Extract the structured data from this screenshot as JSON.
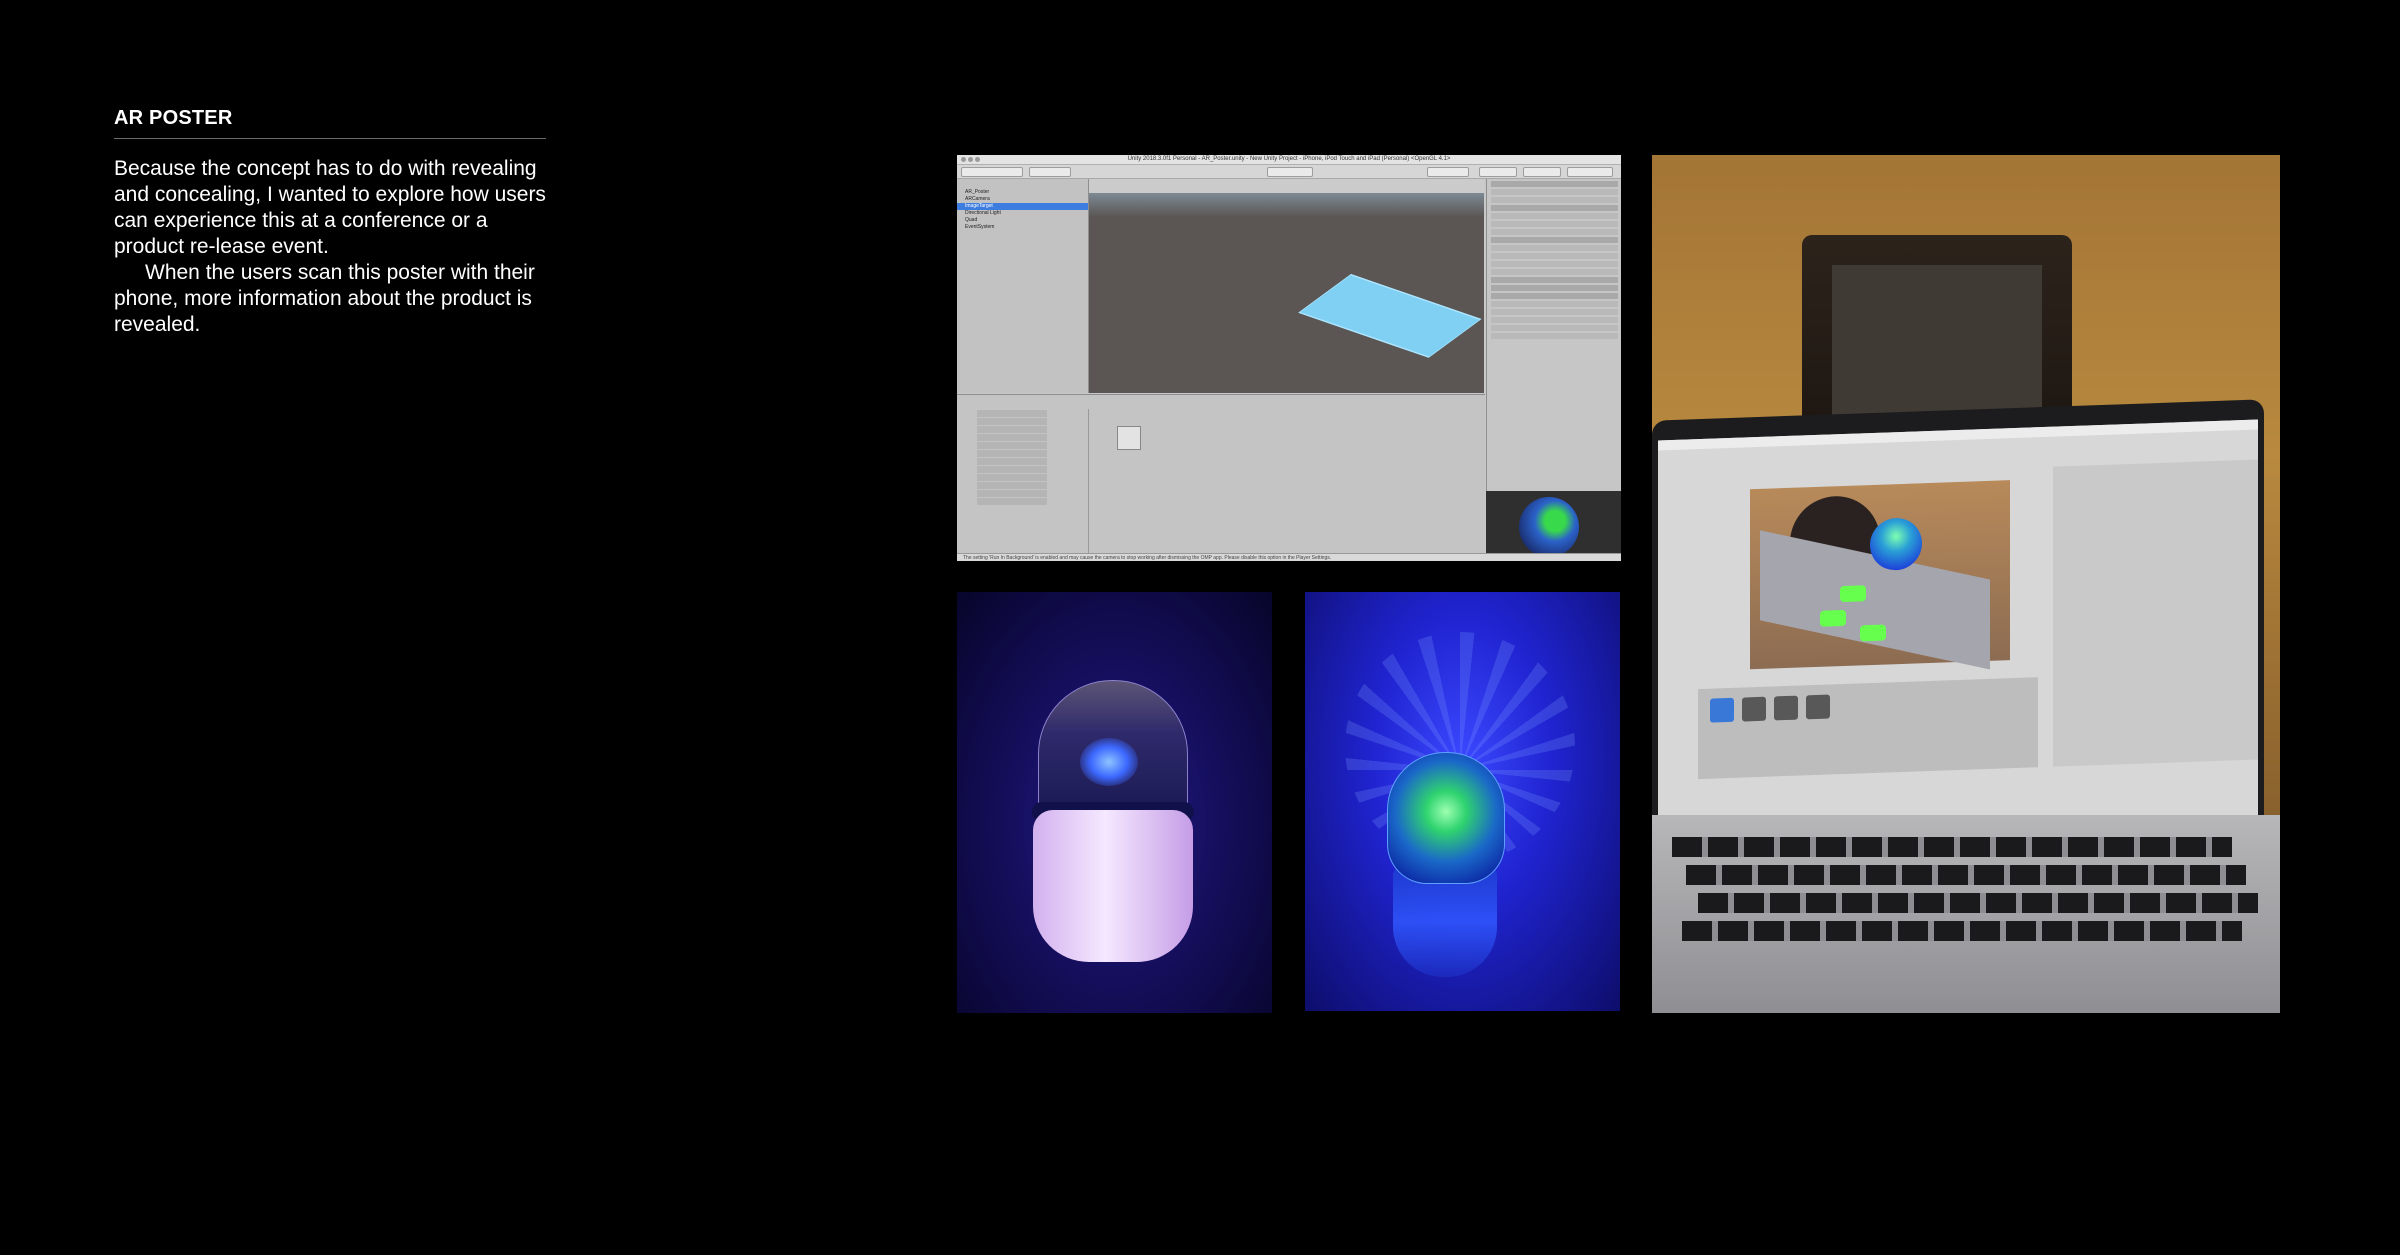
{
  "section": {
    "title": "AR POSTER",
    "paragraph_1": "Because the concept has to do with revealing and concealing, I wanted to explore how users can experience this at a conference or a product re-lease event.",
    "paragraph_2": "When the users scan this poster with their phone, more information about the product is revealed."
  },
  "unity": {
    "window_title": "Unity 2018.3.0f1 Personal - AR_Poster.unity - New Unity Project - iPhone, iPod Touch and iPad (Personal) <OpenGL 4.1>",
    "hierarchy": [
      "AR_Poster",
      "ARCamera",
      "ImageTarget",
      "Directional Light",
      "Quad",
      "EventSystem"
    ],
    "status_bar": "The setting 'Run In Background' is enabled and may cause the camera to stop working after dismissing the OMP app. Please disable this option in the Player Settings."
  },
  "colors": {
    "background": "#000000",
    "text": "#ffffff",
    "rule": "#6b6b6b"
  }
}
